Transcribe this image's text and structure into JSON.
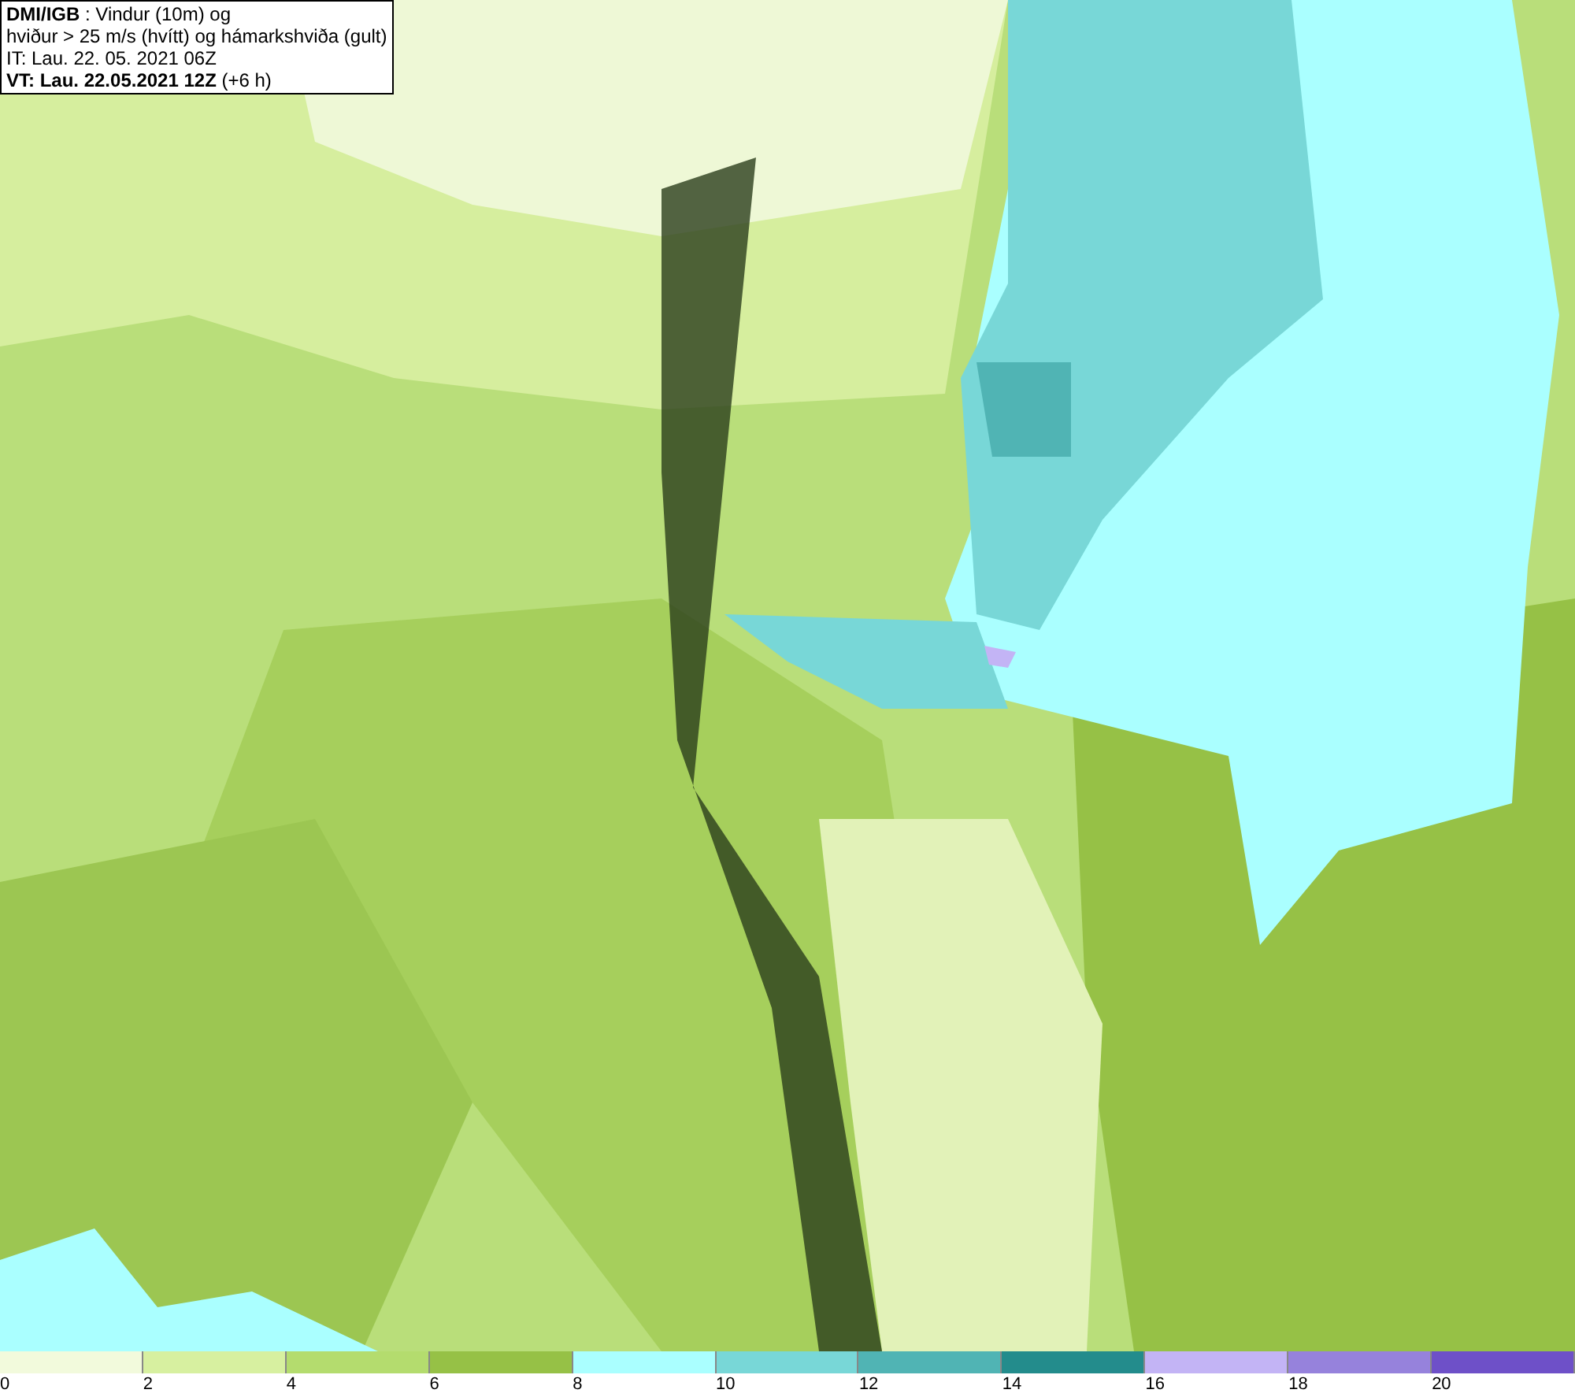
{
  "title_box": {
    "lines": [
      "**DMI/IGB** : Vindur (10m) og",
      "hviður > 25 m/s (hvítt) og hámarkshviða (gult)",
      "IT: Lau. 22. 05. 2021 06Z",
      "**VT: Lau. 22.05.2021 12Z** (+6 h)"
    ]
  },
  "legend": [
    {
      "label": "0",
      "color": "#f2fadc"
    },
    {
      "label": "2",
      "color": "#d7f0a0"
    },
    {
      "label": "4",
      "color": "#b4dc6e"
    },
    {
      "label": "6",
      "color": "#96c146"
    },
    {
      "label": "8",
      "color": "#aaffff"
    },
    {
      "label": "10",
      "color": "#78d7d7"
    },
    {
      "label": "12",
      "color": "#50b4b4"
    },
    {
      "label": "14",
      "color": "#238c8c"
    },
    {
      "label": "16",
      "color": "#c3b4f5"
    },
    {
      "label": "18",
      "color": "#9682dc"
    },
    {
      "label": "20",
      "color": "#6e50c8"
    }
  ]
}
